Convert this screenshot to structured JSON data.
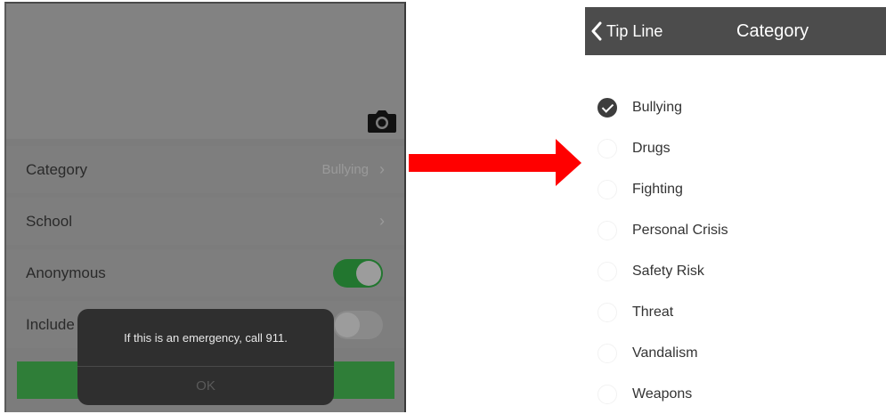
{
  "left_screen": {
    "rows": [
      {
        "label": "Category",
        "value": "Bullying",
        "chevron": "›"
      },
      {
        "label": "School",
        "value": "",
        "chevron": "›"
      },
      {
        "label": "Anonymous",
        "toggle": "on"
      },
      {
        "label": "Include",
        "toggle": "off"
      }
    ],
    "alert": {
      "message": "If this is an emergency, call 911.",
      "button": "OK"
    },
    "colors": {
      "toggle_on": "#22762f",
      "submit_bar": "#2f7e38",
      "overlay": "#7c7c7c"
    }
  },
  "arrow": {
    "color": "#ff0000",
    "icon": "right-arrow-icon"
  },
  "right_screen": {
    "nav": {
      "back_label": "Tip Line",
      "title": "Category"
    },
    "categories": [
      {
        "label": "Bullying",
        "checked": true
      },
      {
        "label": "Drugs",
        "checked": false
      },
      {
        "label": "Fighting",
        "checked": false
      },
      {
        "label": "Personal Crisis",
        "checked": false
      },
      {
        "label": "Safety Risk",
        "checked": false
      },
      {
        "label": "Threat",
        "checked": false
      },
      {
        "label": "Vandalism",
        "checked": false
      },
      {
        "label": "Weapons",
        "checked": false
      }
    ]
  }
}
